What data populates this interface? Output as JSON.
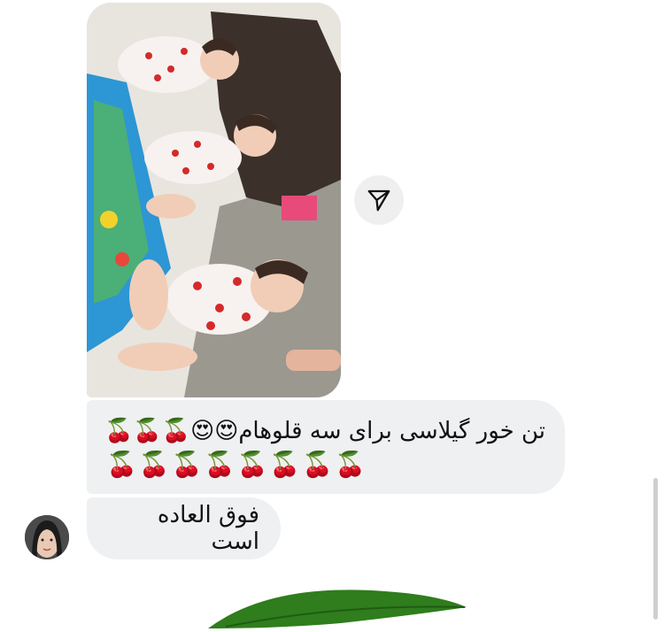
{
  "conversation": {
    "shared_post": {
      "image_description": "three babies in cherry print outfits sitting on floor",
      "share_icon": "send-icon"
    },
    "messages": [
      {
        "text_line_1": "تن خور گیلاسی برای سه قلوهام😍😍🍒🍒🍒",
        "text_line_2": "🍒🍒🍒🍒🍒🍒🍒🍒",
        "sender": "self"
      },
      {
        "text": "فوق العاده است",
        "sender": "other"
      }
    ],
    "avatar_icon": "avatar-woman"
  },
  "colors": {
    "bubble_bg": "#eff0f2",
    "share_button_bg": "#efeff0",
    "leaf_green": "#2f7d1d"
  }
}
